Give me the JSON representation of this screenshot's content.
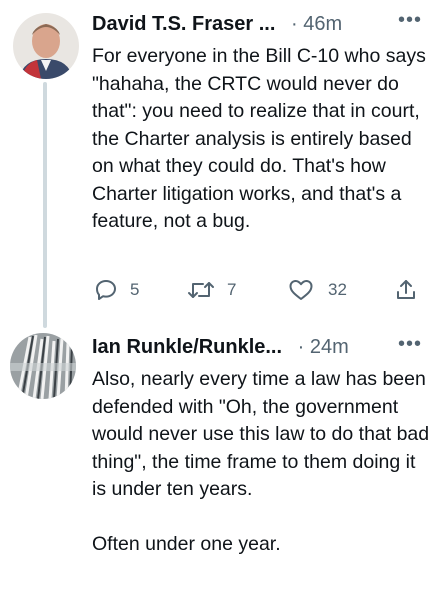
{
  "tweets": [
    {
      "author": "David T.S. Fraser ...",
      "time": "· 46m",
      "more": "•••",
      "text": "For everyone in the Bill C-10 who says \"hahaha, the CRTC would never do that\": you need to realize that in court, the Charter analysis is entirely based on what they could do. That's how Charter litigation works, and that's a feature, not a bug.",
      "actions": {
        "replies": "5",
        "retweets": "7",
        "likes": "32"
      }
    },
    {
      "author": "Ian Runkle/Runkle...",
      "time": "· 24m",
      "more": "•••",
      "text": "Also, nearly every time a law has been defended with \"Oh, the government would never use this law to do that bad thing\", the time frame to them doing it is under ten years.\n\nOften under one year."
    }
  ],
  "colors": {
    "text": "#0f1419",
    "meta": "#536471",
    "thread_line": "#cfd9de"
  },
  "icons": [
    "reply-icon",
    "retweet-icon",
    "like-icon",
    "share-icon",
    "more-icon"
  ]
}
